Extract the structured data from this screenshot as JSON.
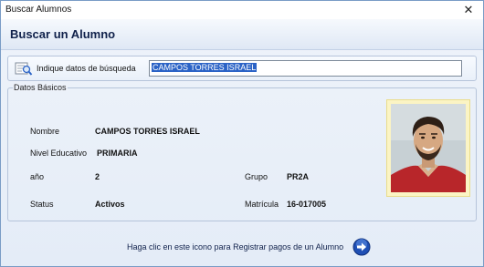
{
  "window": {
    "title": "Buscar Alumnos",
    "close_glyph": "✕"
  },
  "header": {
    "heading": "Buscar un Alumno"
  },
  "search": {
    "icon": "search-record-icon",
    "label": "Indique datos de búsqueda",
    "value": "CAMPOS TORRES ISRAEL"
  },
  "details": {
    "legend": "Datos Básicos",
    "nombre_label": "Nombre",
    "nombre_value": "CAMPOS TORRES ISRAEL",
    "nivel_label": "Nivel Educativo",
    "nivel_value": "PRIMARIA",
    "anio_label": "año",
    "anio_value": "2",
    "grupo_label": "Grupo",
    "grupo_value": "PR2A",
    "status_label": "Status",
    "status_value": "Activos",
    "matricula_label": "Matrícula",
    "matricula_value": "16-017005",
    "photo": "student-photo"
  },
  "footer": {
    "link_text": "Haga clic en este icono para Registrar pagos de un Alumno",
    "button_icon": "arrow-right-icon"
  },
  "colors": {
    "accent": "#2b63c6",
    "heading": "#10214b",
    "photo_frame": "#fbf4c4"
  }
}
